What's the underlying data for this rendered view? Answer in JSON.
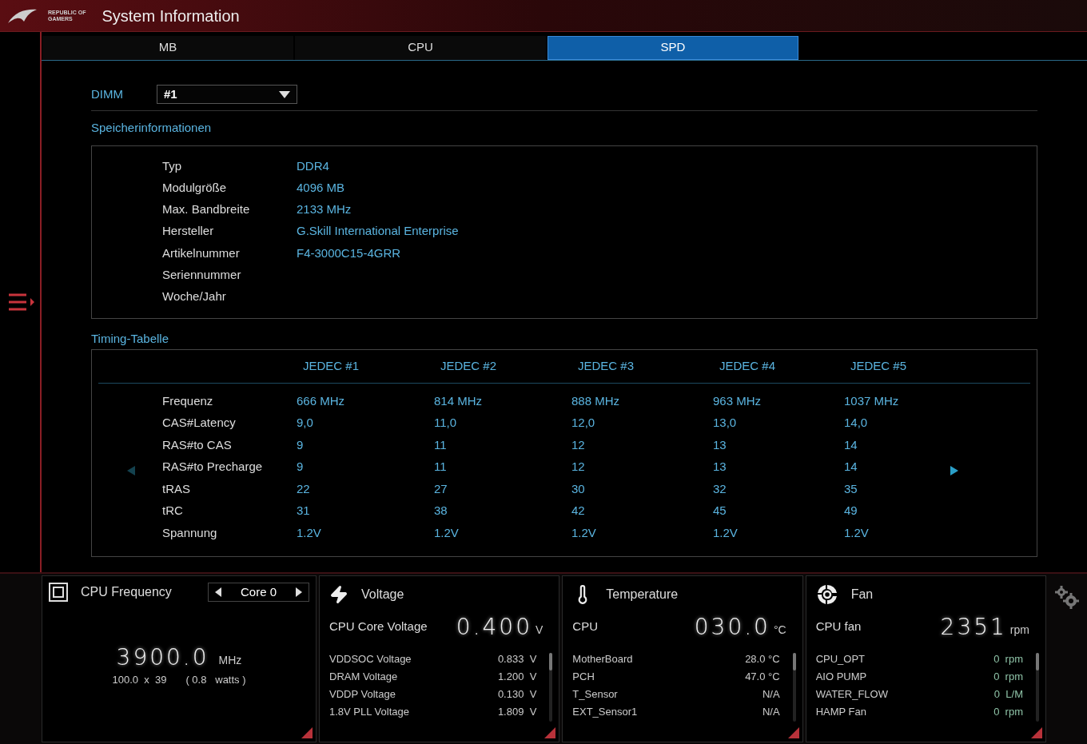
{
  "window": {
    "logo_text": [
      "REPUBLIC OF",
      "GAMERS"
    ],
    "title": "System Information"
  },
  "tabs": [
    {
      "label": "MB",
      "selected": false
    },
    {
      "label": "CPU",
      "selected": false
    },
    {
      "label": "SPD",
      "selected": true
    }
  ],
  "dimm": {
    "label": "DIMM",
    "value": "#1"
  },
  "memory_info": {
    "title": "Speicherinformationen",
    "rows": [
      {
        "label": "Typ",
        "value": "DDR4"
      },
      {
        "label": "Modulgröße",
        "value": "4096 MB"
      },
      {
        "label": "Max. Bandbreite",
        "value": "2133 MHz"
      },
      {
        "label": "Hersteller",
        "value": "G.Skill International Enterprise"
      },
      {
        "label": "Artikelnummer",
        "value": "F4-3000C15-4GRR"
      },
      {
        "label": "Seriennummer",
        "value": ""
      },
      {
        "label": "Woche/Jahr",
        "value": ""
      }
    ]
  },
  "timing_table": {
    "title": "Timing-Tabelle",
    "prev_disabled": true,
    "next_disabled": false,
    "columns": [
      "JEDEC #1",
      "JEDEC #2",
      "JEDEC #3",
      "JEDEC #4",
      "JEDEC #5"
    ],
    "rows": [
      {
        "label": "Frequenz",
        "cells": [
          "666 MHz",
          "814 MHz",
          "888 MHz",
          "963 MHz",
          "1037 MHz"
        ]
      },
      {
        "label": "CAS#Latency",
        "cells": [
          "9,0",
          "11,0",
          "12,0",
          "13,0",
          "14,0"
        ]
      },
      {
        "label": "RAS#to CAS",
        "cells": [
          "9",
          "11",
          "12",
          "13",
          "14"
        ]
      },
      {
        "label": "RAS#to Precharge",
        "cells": [
          "9",
          "11",
          "12",
          "13",
          "14"
        ]
      },
      {
        "label": "tRAS",
        "cells": [
          "22",
          "27",
          "30",
          "32",
          "35"
        ]
      },
      {
        "label": "tRC",
        "cells": [
          "31",
          "38",
          "42",
          "45",
          "49"
        ]
      },
      {
        "label": "Spannung",
        "cells": [
          "1.2V",
          "1.2V",
          "1.2V",
          "1.2V",
          "1.2V"
        ]
      }
    ]
  },
  "cpu_frequency": {
    "title": "CPU Frequency",
    "core": "Core 0",
    "value": "3900.0",
    "unit": "MHz",
    "multiplier": "100.0  x  39",
    "power": "( 0.8   watts )"
  },
  "monitors": [
    {
      "kind": "voltage",
      "title": "Voltage",
      "main_label": "CPU Core Voltage",
      "main_value": "0.400",
      "main_unit": "V",
      "rows": [
        {
          "label": "VDDSOC Voltage",
          "value": "0.833",
          "unit": "V"
        },
        {
          "label": "DRAM Voltage",
          "value": "1.200",
          "unit": "V"
        },
        {
          "label": "VDDP Voltage",
          "value": "0.130",
          "unit": "V"
        },
        {
          "label": "1.8V PLL Voltage",
          "value": "1.809",
          "unit": "V"
        }
      ]
    },
    {
      "kind": "temperature",
      "title": "Temperature",
      "main_label": "CPU",
      "main_value": "030.0",
      "main_unit": "°C",
      "rows": [
        {
          "label": "MotherBoard",
          "value": "28.0 °C"
        },
        {
          "label": "PCH",
          "value": "47.0 °C"
        },
        {
          "label": "T_Sensor",
          "value": "N/A"
        },
        {
          "label": "EXT_Sensor1",
          "value": "N/A"
        }
      ]
    },
    {
      "kind": "fan",
      "title": "Fan",
      "main_label": "CPU fan",
      "main_value": "2351",
      "main_unit": "rpm",
      "rows": [
        {
          "label": "CPU_OPT",
          "value": "0",
          "unit": "rpm"
        },
        {
          "label": "AIO PUMP",
          "value": "0",
          "unit": "rpm"
        },
        {
          "label": "WATER_FLOW",
          "value": "0",
          "unit": "L/M"
        },
        {
          "label": "HAMP Fan",
          "value": "0",
          "unit": "rpm"
        }
      ]
    }
  ]
}
